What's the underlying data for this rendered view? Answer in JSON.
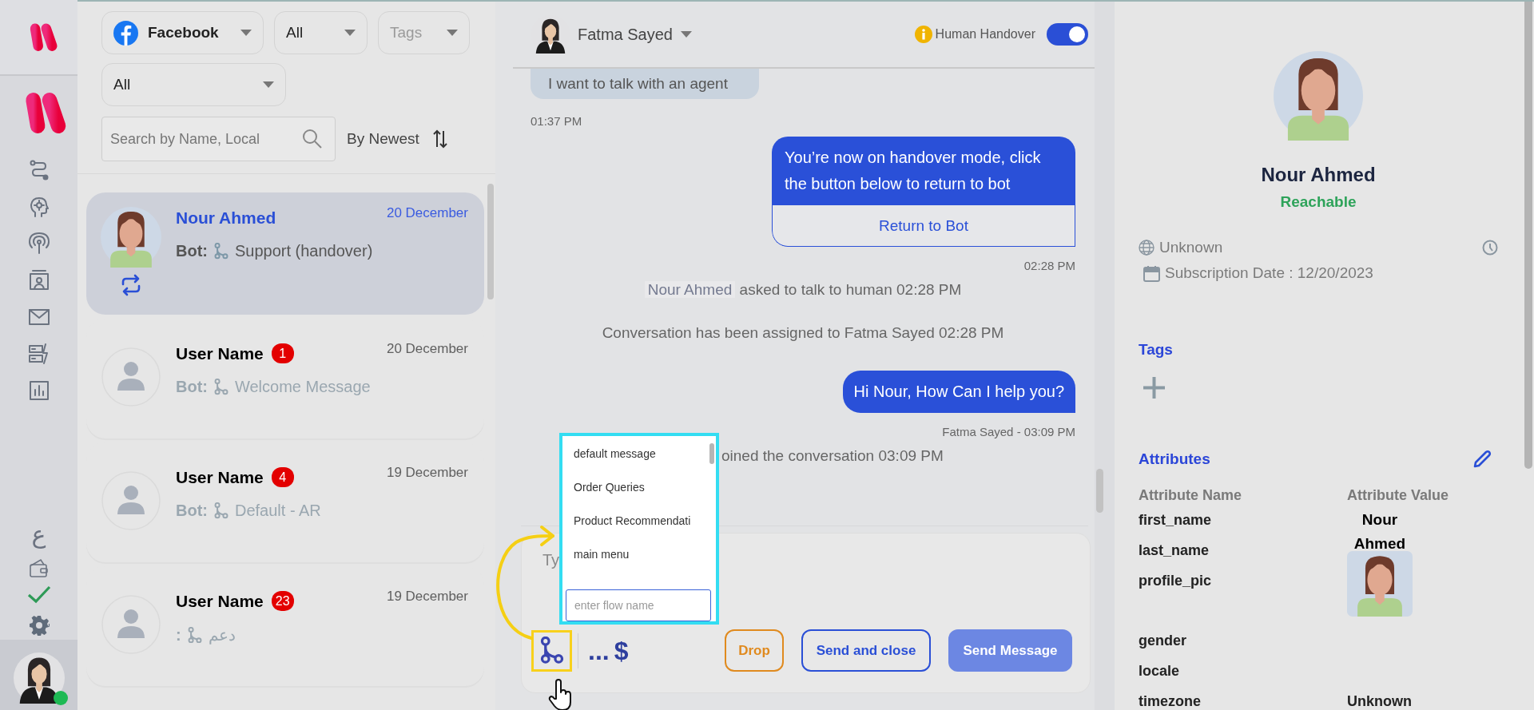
{
  "rail": {
    "language": "ع",
    "agent_online": true
  },
  "filters": {
    "channel": "Facebook",
    "status": "All",
    "tags_placeholder": "Tags",
    "scope": "All"
  },
  "search": {
    "placeholder": "Search by Name, Local"
  },
  "sort": {
    "label": "By Newest"
  },
  "conversations": [
    {
      "name": "Nour Ahmed",
      "date": "20 December",
      "bot_label": "Bot:",
      "flow": "Support (handover)",
      "selected": true,
      "handover": true
    },
    {
      "name": "User Name",
      "badge": "1",
      "date": "20 December",
      "bot_label": "Bot:",
      "flow": "Welcome Message",
      "selected": false,
      "handover": false,
      "kind": "placeholder"
    },
    {
      "name": "User Name",
      "badge": "4",
      "date": "19 December",
      "bot_label": "Bot:",
      "flow": "Default - AR",
      "selected": false,
      "handover": false,
      "kind": "placeholder"
    },
    {
      "name": "User Name",
      "badge": "23",
      "date": "19 December",
      "bot_label": ":",
      "flow": "دعم",
      "selected": false,
      "handover": false,
      "kind": "placeholder"
    }
  ],
  "chat": {
    "agent": "Fatma Sayed",
    "handover_label": "Human Handover",
    "handover_on": true,
    "messages": [
      {
        "kind": "incoming",
        "text": "I want to talk with an agent"
      },
      {
        "kind": "time_left",
        "text": "01:37 PM"
      },
      {
        "kind": "outgoing",
        "text": "You’re now on handover mode, click the button below to return to bot",
        "button": "Return to Bot"
      },
      {
        "kind": "time_right",
        "text": "02:28 PM"
      },
      {
        "kind": "system",
        "name": "Nour Ahmed",
        "text": "asked to talk to human 02:28 PM"
      },
      {
        "kind": "system",
        "text": "Conversation has been assigned to Fatma Sayed 02:28 PM"
      },
      {
        "kind": "outgoing",
        "text": "Hi Nour, How Can I help you?"
      },
      {
        "kind": "time_right",
        "text": "Fatma Sayed - 03:09 PM"
      },
      {
        "kind": "system_covered",
        "text": "oined the conversation 03:09 PM"
      }
    ],
    "composer": {
      "placeholder": "Ty",
      "more": "...",
      "currency": "$",
      "buttons": [
        {
          "label": "Drop",
          "kind": "drop"
        },
        {
          "label": "Send and close",
          "kind": "outline"
        },
        {
          "label": "Send Message",
          "kind": "primary"
        }
      ]
    },
    "flow_picker": {
      "items": [
        "default message",
        "Order Queries",
        "Product Recommendati",
        "main menu"
      ],
      "placeholder": "enter flow name"
    }
  },
  "contact": {
    "name": "Nour Ahmed",
    "status": "Reachable",
    "location": "Unknown",
    "subscription": "Subscription Date : 12/20/2023",
    "tags_title": "Tags",
    "attributes_title": "Attributes",
    "columns": [
      "Attribute Name",
      "Attribute Value"
    ],
    "attributes": [
      {
        "name": "first_name",
        "kind": "text",
        "value": "Nour Ahmed"
      },
      {
        "name": "last_name",
        "kind": "text"
      },
      {
        "name": "profile_pic",
        "kind": "picture"
      },
      {
        "name": "gender",
        "kind": "text"
      },
      {
        "name": "locale",
        "kind": "text"
      },
      {
        "name": "timezone",
        "kind": "text",
        "value": "Unknown"
      }
    ]
  }
}
